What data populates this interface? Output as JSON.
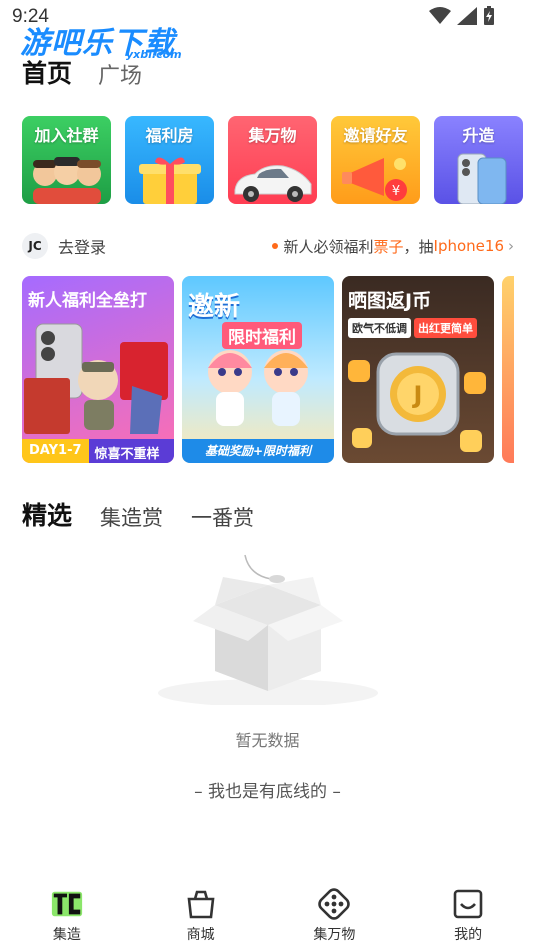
{
  "status": {
    "time": "9:24"
  },
  "watermark": {
    "main": "游吧乐下载",
    "sub": "yxbl.com"
  },
  "header": {
    "tabs": [
      {
        "label": "首页"
      },
      {
        "label": "广场"
      }
    ]
  },
  "tiles": [
    {
      "label": "加入社群",
      "bg": "#2fbf57"
    },
    {
      "label": "福利房",
      "bg": "#1ea6ff"
    },
    {
      "label": "集万物",
      "bg": "#ff4d5e"
    },
    {
      "label": "邀请好友",
      "bg": "#ffb020"
    },
    {
      "label": "升造",
      "bg": "#6a63ff"
    }
  ],
  "login": {
    "avatar_text": "JC",
    "label": "去登录"
  },
  "notice": {
    "prefix": "新人必领福利",
    "highlight1": "票子",
    "middle": "，抽",
    "highlight2": "Iphone16",
    "chevron": "›"
  },
  "banners": [
    {
      "title": "新人福利全垒打",
      "tag1": "DAY1-7",
      "tag2": "惊喜不重样",
      "bg1": "#9b5cff",
      "bg2": "#ff5da8"
    },
    {
      "title": "邀新",
      "subtitle": "限时福利",
      "footer": "基础奖励+限时福利",
      "bg1": "#5ec8ff",
      "bg2": "#ffe9b0"
    },
    {
      "title": "晒图返J币",
      "tag1": "欧气不低调",
      "tag2": "出红更简单",
      "bg1": "#3a2a22",
      "bg2": "#6b4a33"
    }
  ],
  "content_tabs": [
    {
      "label": "精选"
    },
    {
      "label": "集造赏"
    },
    {
      "label": "一番赏"
    }
  ],
  "empty": {
    "message": "暂无数据",
    "bottom": "– 我也是有底线的 –"
  },
  "bottom_nav": [
    {
      "label": "集造",
      "active": true
    },
    {
      "label": "商城"
    },
    {
      "label": "集万物"
    },
    {
      "label": "我的"
    }
  ]
}
